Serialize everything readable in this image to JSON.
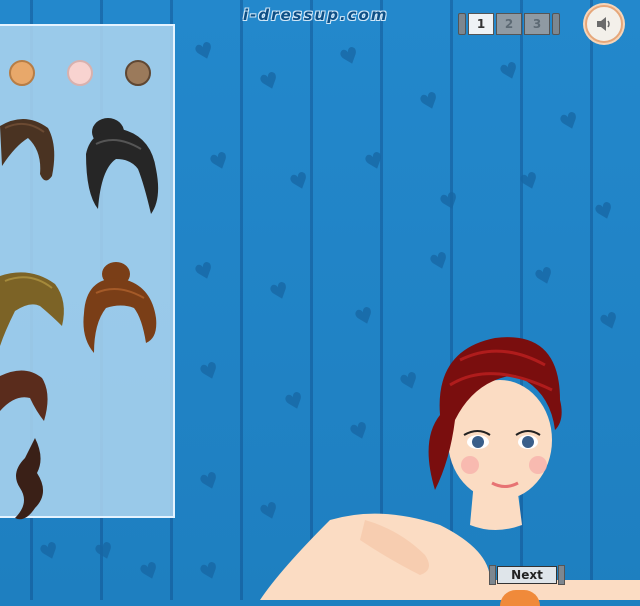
{
  "header": {
    "logo_text": "i-dressup.com"
  },
  "pager": {
    "pages": [
      "1",
      "2",
      "3"
    ],
    "active": "1"
  },
  "sound": {
    "icon": "speaker-icon"
  },
  "panel": {
    "skin_swatches": [
      {
        "name": "tan",
        "color": "#e8a86a"
      },
      {
        "name": "light-pink",
        "color": "#f8d3d0"
      },
      {
        "name": "brown",
        "color": "#9b7a5b"
      }
    ],
    "hair_options": [
      {
        "name": "dark-brown-short",
        "color": "#4a3322"
      },
      {
        "name": "black-updo",
        "color": "#262626"
      },
      {
        "name": "blonde-olive",
        "color": "#7c6326"
      },
      {
        "name": "auburn-bun",
        "color": "#7a3e17"
      },
      {
        "name": "brown-wavy",
        "color": "#5a2c1c"
      },
      {
        "name": "dark-wavy-long",
        "color": "#3a2017"
      }
    ]
  },
  "model": {
    "hair_color": "#7a0e0e",
    "skin_color": "#fbdcc3"
  },
  "next_button": {
    "label": "Next"
  }
}
